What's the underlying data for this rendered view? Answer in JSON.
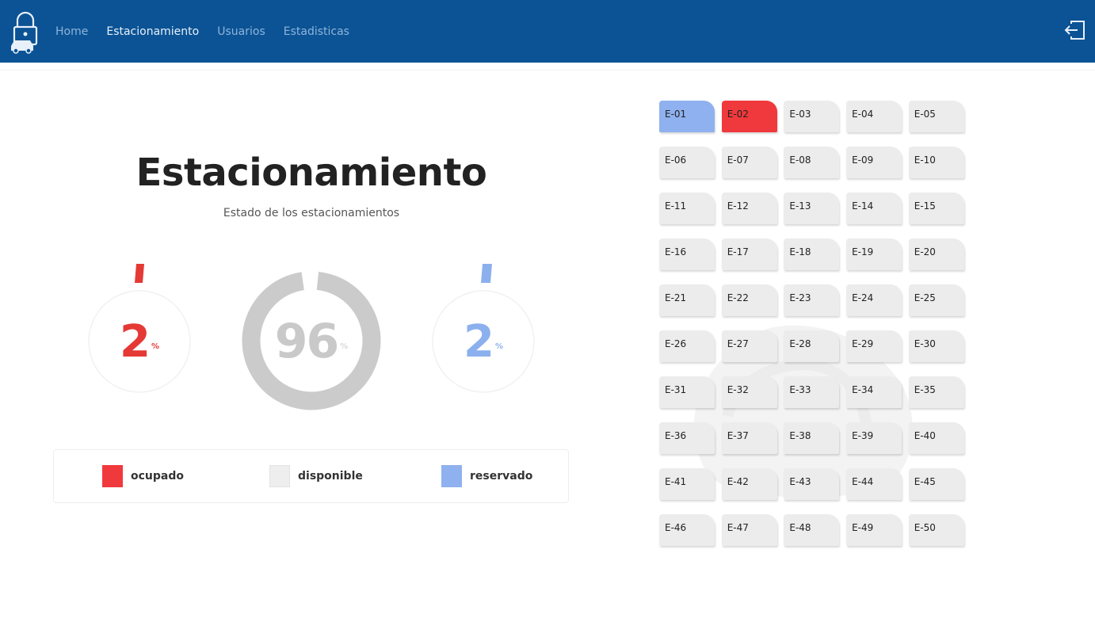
{
  "nav": {
    "links": [
      "Home",
      "Estacionamiento",
      "Usuarios",
      "Estadisticas"
    ],
    "active": "Estacionamiento"
  },
  "page": {
    "title": "Estacionamiento",
    "subtitle": "Estado de los estacionamientos"
  },
  "stats": {
    "ocupado": {
      "value": "2",
      "unit": "%",
      "fraction": 0.02,
      "color": "#e53935"
    },
    "disponible": {
      "value": "96",
      "unit": "%",
      "fraction": 0.96,
      "color": "#c8c8c8"
    },
    "reservado": {
      "value": "2",
      "unit": "%",
      "fraction": 0.02,
      "color": "#8cb0ee"
    }
  },
  "legend": [
    {
      "label": "ocupado",
      "color": "#f0393c"
    },
    {
      "label": "disponible",
      "color": "#eeeeee"
    },
    {
      "label": "reservado",
      "color": "#8fb1ef"
    }
  ],
  "spots": [
    {
      "id": "E-01",
      "status": "reservado"
    },
    {
      "id": "E-02",
      "status": "ocupado"
    },
    {
      "id": "E-03",
      "status": "disponible"
    },
    {
      "id": "E-04",
      "status": "disponible"
    },
    {
      "id": "E-05",
      "status": "disponible"
    },
    {
      "id": "E-06",
      "status": "disponible"
    },
    {
      "id": "E-07",
      "status": "disponible"
    },
    {
      "id": "E-08",
      "status": "disponible"
    },
    {
      "id": "E-09",
      "status": "disponible"
    },
    {
      "id": "E-10",
      "status": "disponible"
    },
    {
      "id": "E-11",
      "status": "disponible"
    },
    {
      "id": "E-12",
      "status": "disponible"
    },
    {
      "id": "E-13",
      "status": "disponible"
    },
    {
      "id": "E-14",
      "status": "disponible"
    },
    {
      "id": "E-15",
      "status": "disponible"
    },
    {
      "id": "E-16",
      "status": "disponible"
    },
    {
      "id": "E-17",
      "status": "disponible"
    },
    {
      "id": "E-18",
      "status": "disponible"
    },
    {
      "id": "E-19",
      "status": "disponible"
    },
    {
      "id": "E-20",
      "status": "disponible"
    },
    {
      "id": "E-21",
      "status": "disponible"
    },
    {
      "id": "E-22",
      "status": "disponible"
    },
    {
      "id": "E-23",
      "status": "disponible"
    },
    {
      "id": "E-24",
      "status": "disponible"
    },
    {
      "id": "E-25",
      "status": "disponible"
    },
    {
      "id": "E-26",
      "status": "disponible"
    },
    {
      "id": "E-27",
      "status": "disponible"
    },
    {
      "id": "E-28",
      "status": "disponible"
    },
    {
      "id": "E-29",
      "status": "disponible"
    },
    {
      "id": "E-30",
      "status": "disponible"
    },
    {
      "id": "E-31",
      "status": "disponible"
    },
    {
      "id": "E-32",
      "status": "disponible"
    },
    {
      "id": "E-33",
      "status": "disponible"
    },
    {
      "id": "E-34",
      "status": "disponible"
    },
    {
      "id": "E-35",
      "status": "disponible"
    },
    {
      "id": "E-36",
      "status": "disponible"
    },
    {
      "id": "E-37",
      "status": "disponible"
    },
    {
      "id": "E-38",
      "status": "disponible"
    },
    {
      "id": "E-39",
      "status": "disponible"
    },
    {
      "id": "E-40",
      "status": "disponible"
    },
    {
      "id": "E-41",
      "status": "disponible"
    },
    {
      "id": "E-42",
      "status": "disponible"
    },
    {
      "id": "E-43",
      "status": "disponible"
    },
    {
      "id": "E-44",
      "status": "disponible"
    },
    {
      "id": "E-45",
      "status": "disponible"
    },
    {
      "id": "E-46",
      "status": "disponible"
    },
    {
      "id": "E-47",
      "status": "disponible"
    },
    {
      "id": "E-48",
      "status": "disponible"
    },
    {
      "id": "E-49",
      "status": "disponible"
    },
    {
      "id": "E-50",
      "status": "disponible"
    }
  ],
  "icons": {
    "logo": "parking-lock-car-icon",
    "logout": "logout-icon",
    "background": "car-silhouette-icon"
  }
}
